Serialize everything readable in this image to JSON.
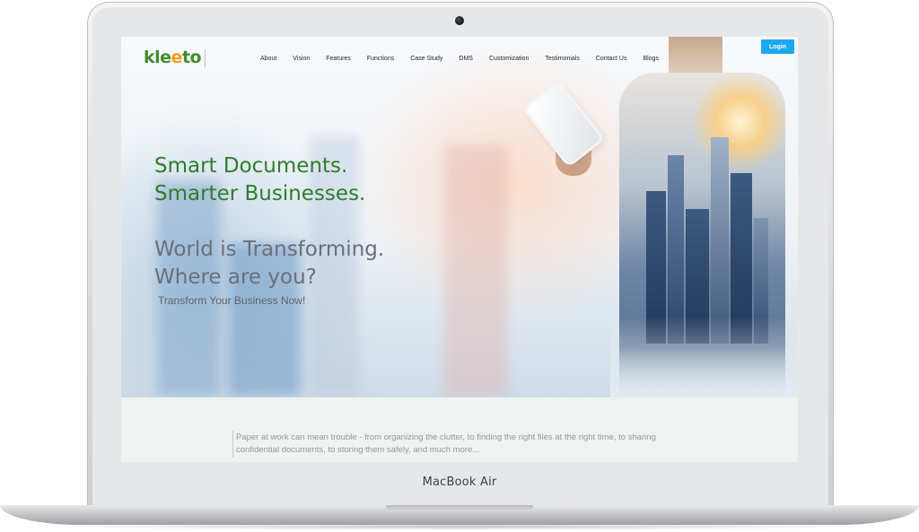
{
  "device": {
    "model_label": "MacBook Air"
  },
  "site": {
    "logo": {
      "main": "kle",
      "accent": "e",
      "rest": "to"
    },
    "nav": [
      "About",
      "Vision",
      "Features",
      "Functions",
      "Case Study",
      "DMS",
      "Customization",
      "Testimonials",
      "Contact Us",
      "Blogs"
    ],
    "login_label": "Login",
    "hero": {
      "headline_line1": "Smart Documents.",
      "headline_line2": "Smarter Businesses.",
      "sub_line1": "World is Transforming.",
      "sub_line2": "Where are you?",
      "tagline": "Transform Your Business Now!"
    },
    "intro_text": "Paper at work can mean trouble - from organizing the clutter, to finding the right files at the right time, to sharing confidential documents, to storing them safely, and much more..."
  },
  "colors": {
    "brand_green": "#2e7d2c",
    "logo_orange": "#f39a1e",
    "login_blue": "#1aa9ef",
    "subheading_gray": "#68707a"
  }
}
